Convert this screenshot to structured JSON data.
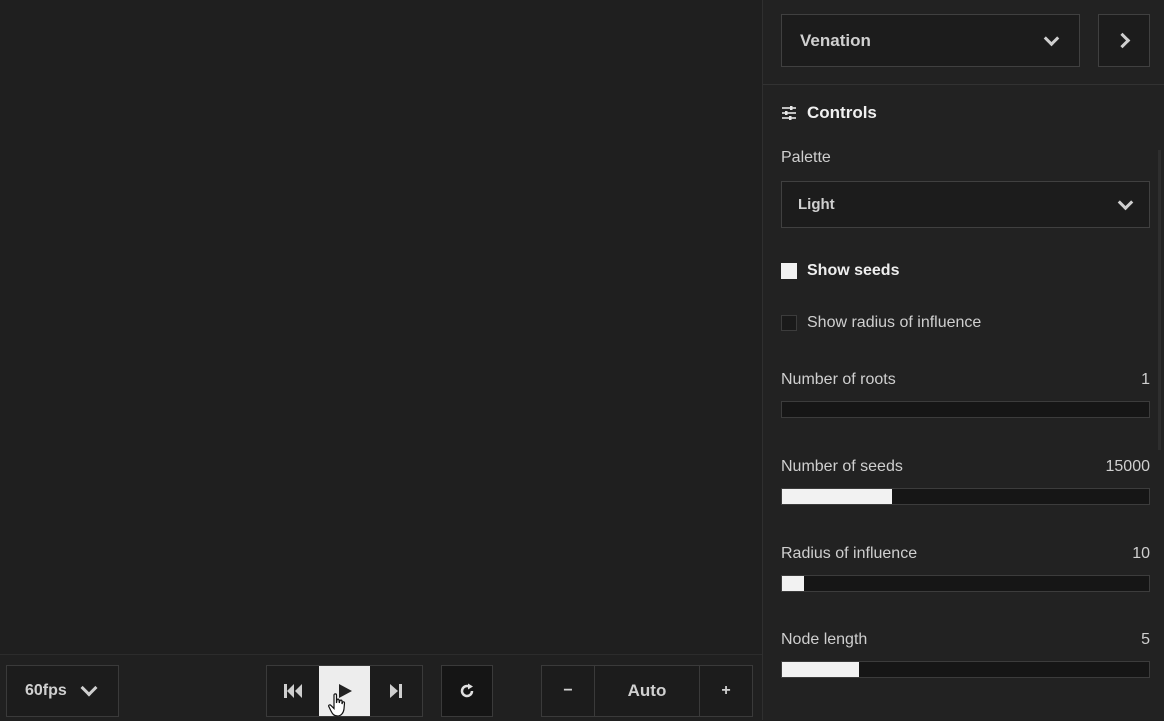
{
  "bottom_bar": {
    "fps_label": "60fps",
    "zoom_label": "Auto",
    "zoom_minus": "−",
    "zoom_plus": "+"
  },
  "sidebar": {
    "algorithm_select": "Venation",
    "controls_title": "Controls",
    "palette_label": "Palette",
    "palette_value": "Light",
    "show_seeds": {
      "label": "Show seeds",
      "checked": true
    },
    "show_radius": {
      "label": "Show radius of influence",
      "checked": false
    },
    "sliders": [
      {
        "label": "Number of roots",
        "value": "1",
        "fill": 0.0
      },
      {
        "label": "Number of seeds",
        "value": "15000",
        "fill": 0.3
      },
      {
        "label": "Radius of influence",
        "value": "10",
        "fill": 0.06
      },
      {
        "label": "Node length",
        "value": "5",
        "fill": 0.21
      }
    ]
  }
}
